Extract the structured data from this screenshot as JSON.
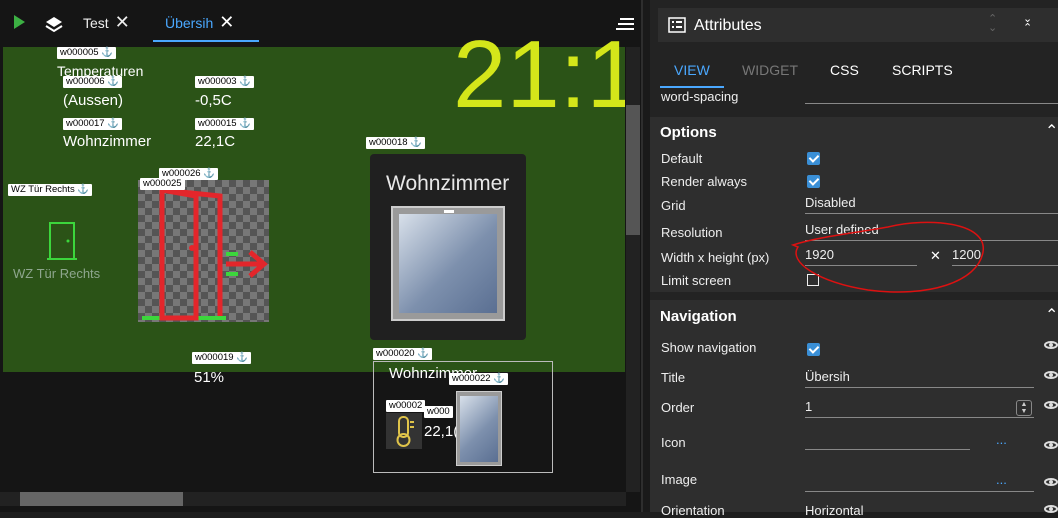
{
  "tabs": [
    {
      "label": "Test",
      "close": "✕"
    },
    {
      "label": "Übersih",
      "close": "✕"
    }
  ],
  "canvas": {
    "tags": {
      "w5": "w000005 ⚓",
      "w6": "w000006 ⚓",
      "w3": "w000003 ⚓",
      "w17": "w000017 ⚓",
      "w15": "w000015 ⚓",
      "w26": "w000026 ⚓",
      "w25": "w000025",
      "w18": "w000018 ⚓",
      "wz": "WZ Tür Rechts ⚓",
      "w19": "w000019 ⚓",
      "w20": "w000020 ⚓",
      "w22": "w000022 ⚓",
      "w23": "w00002",
      "w24": "w000"
    },
    "temperaturen": "Temperaturen",
    "aussen": "(Aussen)",
    "aussen_value": "-0,5C",
    "wohnzimmer": "Wohnzimmer",
    "wz_value": "22,1C",
    "clock": "21:1",
    "wz_door_label": "WZ Tür Rechts",
    "card_title": "Wohnzimmer",
    "percent": "51%",
    "group_title": "Wohnzimmer",
    "group_value": "22,1("
  },
  "attributes": {
    "title": "Attributes",
    "tabs": [
      "VIEW",
      "WIDGET",
      "CSS",
      "SCRIPTS"
    ],
    "word_spacing": "word-spacing",
    "options": {
      "header": "Options",
      "default": "Default",
      "render_always": "Render always",
      "grid": "Grid",
      "grid_value": "Disabled",
      "resolution": "Resolution",
      "resolution_value": "User defined",
      "wh": "Width x height (px)",
      "width": "1920",
      "times": "✕",
      "height": "1200",
      "limit": "Limit screen"
    },
    "navigation": {
      "header": "Navigation",
      "show": "Show navigation",
      "title": "Title",
      "title_value": "Übersih",
      "order": "Order",
      "order_value": "1",
      "icon": "Icon",
      "image": "Image",
      "orientation": "Orientation",
      "orientation_value": "Horizontal",
      "dots": "..."
    }
  }
}
